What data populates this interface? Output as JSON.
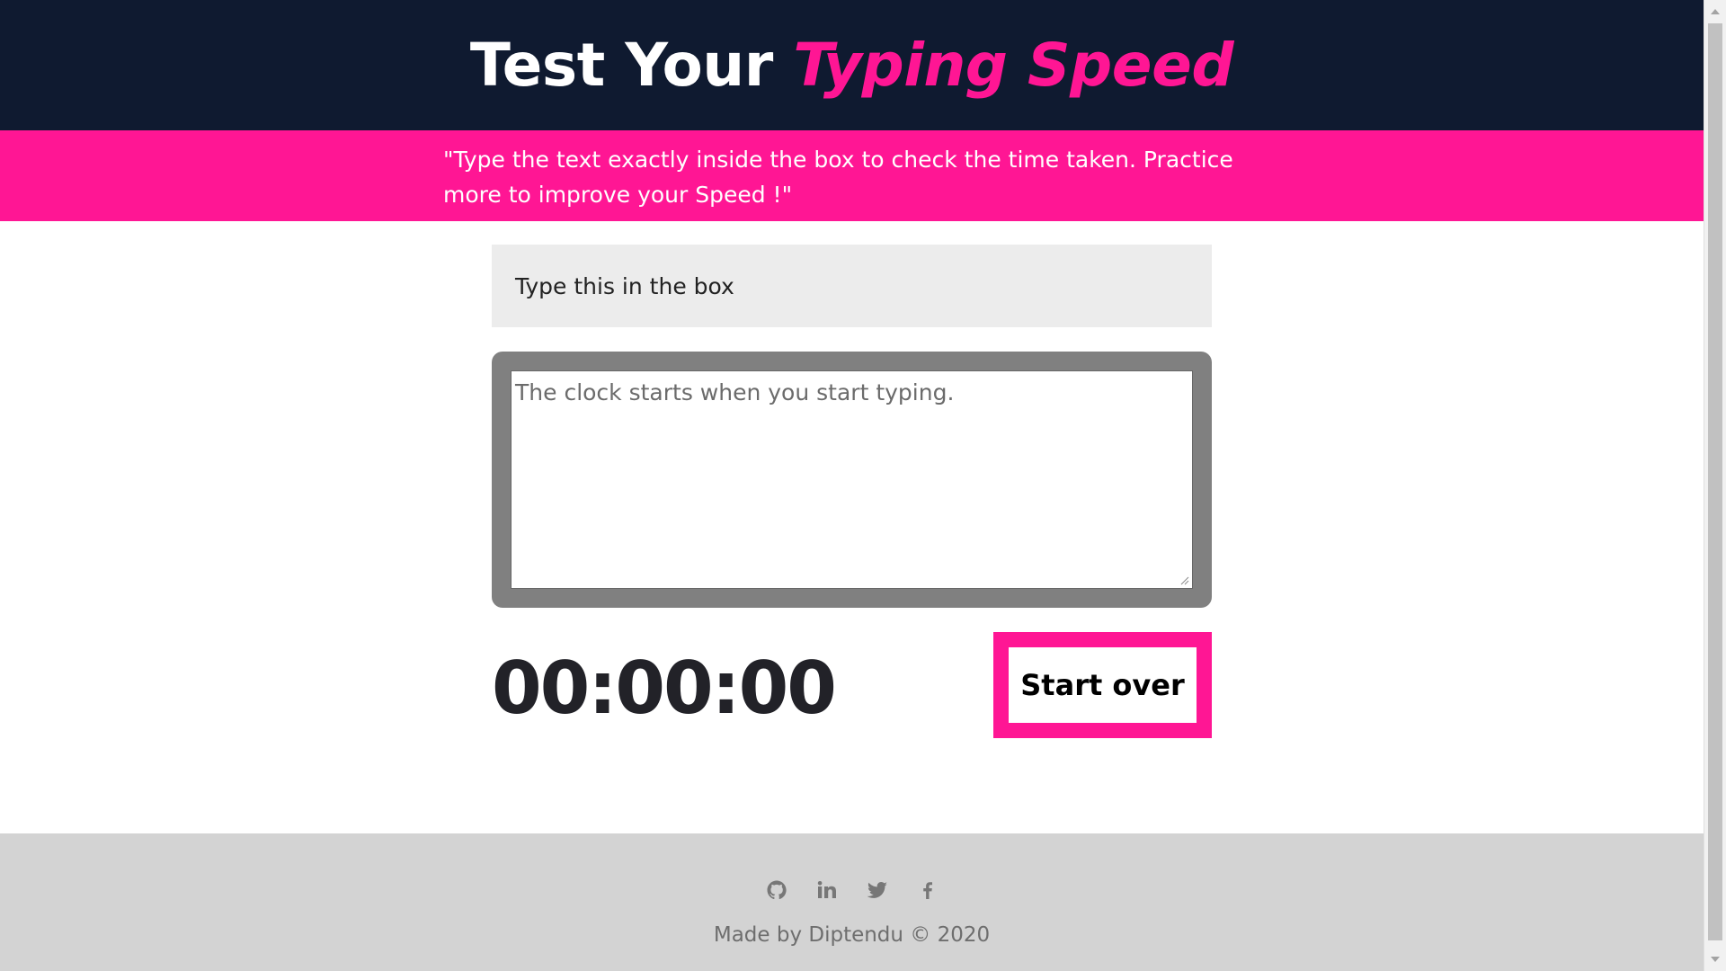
{
  "header": {
    "title_plain": "Test Your ",
    "title_accent": "Typing Speed"
  },
  "intro": {
    "text": "\"Type the text exactly inside the box to check the time taken. Practice more to improve your Speed !\""
  },
  "test": {
    "origin_text": "Type this in the box",
    "input_value": "",
    "input_placeholder": "The clock starts when you start typing."
  },
  "timer": {
    "value": "00:00:00"
  },
  "reset_button": {
    "label": "Start over"
  },
  "footer": {
    "social_icons": [
      "github-icon",
      "linkedin-icon",
      "twitter-icon",
      "facebook-icon"
    ],
    "copyright": "Made by Diptendu © 2020"
  },
  "colors": {
    "header_bg": "#0f1a30",
    "accent": "#ff1694",
    "footer_bg": "#d3d3d3",
    "textarea_frame": "#808080"
  }
}
